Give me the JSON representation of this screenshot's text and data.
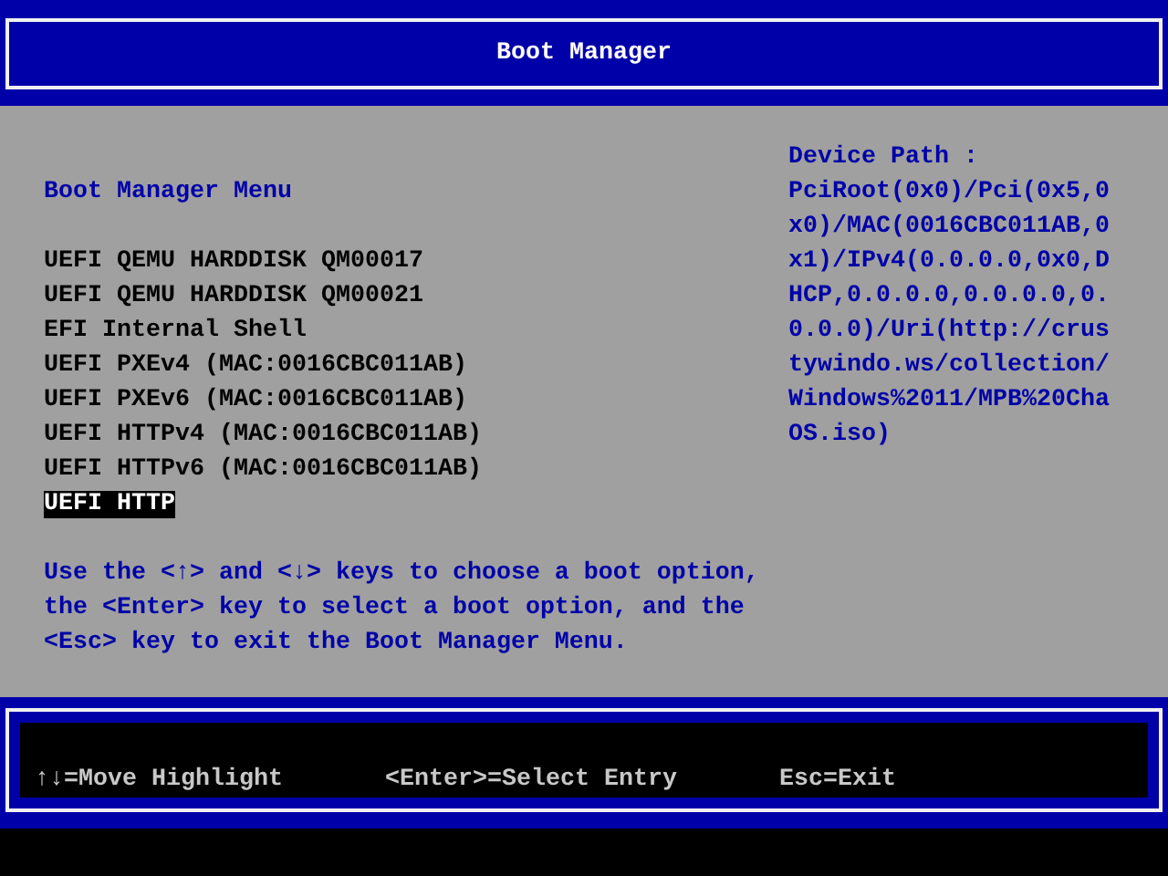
{
  "header": {
    "title": "Boot Manager"
  },
  "menu": {
    "title": "Boot Manager Menu",
    "items": [
      {
        "label": "UEFI QEMU HARDDISK QM00017",
        "selected": false
      },
      {
        "label": "UEFI QEMU HARDDISK QM00021",
        "selected": false
      },
      {
        "label": "EFI Internal Shell",
        "selected": false
      },
      {
        "label": "UEFI PXEv4 (MAC:0016CBC011AB)",
        "selected": false
      },
      {
        "label": "UEFI PXEv6 (MAC:0016CBC011AB)",
        "selected": false
      },
      {
        "label": "UEFI HTTPv4 (MAC:0016CBC011AB)",
        "selected": false
      },
      {
        "label": "UEFI HTTPv6 (MAC:0016CBC011AB)",
        "selected": false
      },
      {
        "label": "UEFI HTTP",
        "selected": true
      }
    ],
    "help": [
      "Use the <↑> and <↓> keys to choose a boot option,",
      "the <Enter> key to select a boot option, and the",
      "<Esc> key to exit the Boot Manager Menu."
    ]
  },
  "device_path": {
    "label": "Device Path :",
    "value": "PciRoot(0x0)/Pci(0x5,0x0)/MAC(0016CBC011AB,0x1)/IPv4(0.0.0.0,0x0,DHCP,0.0.0.0,0.0.0.0,0.0.0.0)/Uri(http://crustywindo.ws/collection/Windows%2011/MPB%20ChaOS.iso)"
  },
  "footer": {
    "keys": [
      "↑↓=Move Highlight",
      "<Enter>=Select Entry",
      "Esc=Exit"
    ]
  }
}
